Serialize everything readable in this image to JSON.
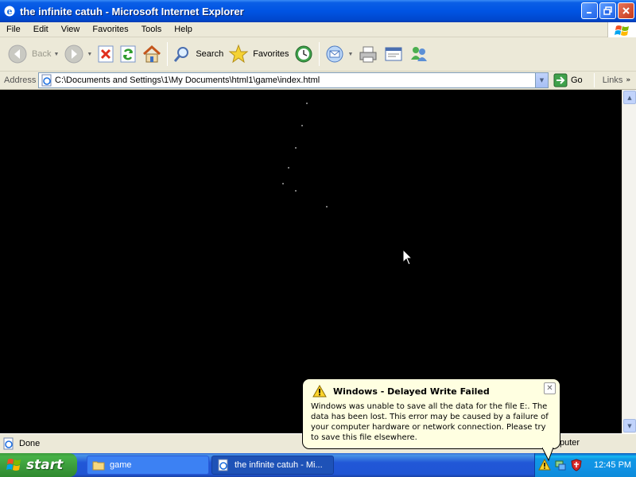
{
  "window": {
    "title": "the infinite catuh - Microsoft Internet Explorer"
  },
  "menu": [
    "File",
    "Edit",
    "View",
    "Favorites",
    "Tools",
    "Help"
  ],
  "toolbar": {
    "back_label": "Back",
    "search_label": "Search",
    "favorites_label": "Favorites"
  },
  "address": {
    "label": "Address",
    "value": "C:\\Documents and Settings\\1\\My Documents\\html1\\game\\index.html",
    "go_label": "Go",
    "links_label": "Links"
  },
  "status": {
    "text": "Done",
    "zone": "puter"
  },
  "taskbar": {
    "start_label": "start",
    "items": [
      {
        "label": "game"
      },
      {
        "label": "the infinite catuh - Mi..."
      }
    ],
    "clock": "12:45 PM"
  },
  "balloon": {
    "title": "Windows - Delayed Write Failed",
    "body": "Windows was unable to save all the data for the file E:. The data has been lost. This error may be caused by a failure of your computer hardware or network connection. Please try to save this file elsewhere."
  },
  "colors": {
    "titlebar": "#0054e3",
    "chrome": "#ece9d8",
    "content_bg": "#000000",
    "balloon_bg": "#ffffe1",
    "start_green": "#3a9a3a",
    "taskbar_blue": "#2157d7"
  }
}
